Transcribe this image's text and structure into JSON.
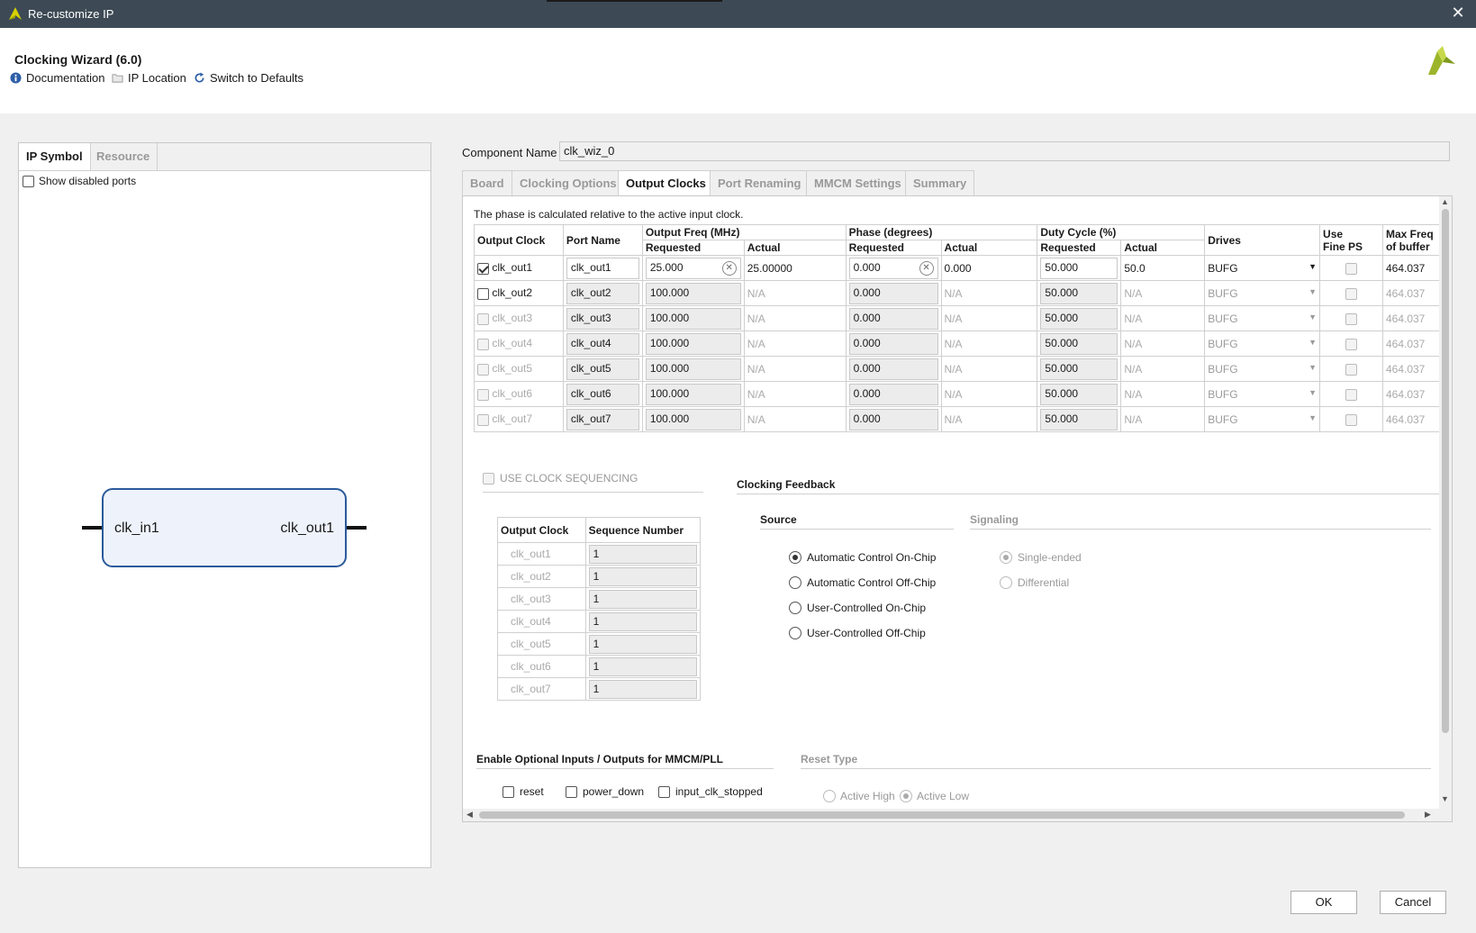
{
  "window": {
    "title": "Re-customize IP"
  },
  "header": {
    "heading": "Clocking Wizard (6.0)",
    "toolbar": [
      {
        "label": "Documentation",
        "icon": "info-icon"
      },
      {
        "label": "IP Location",
        "icon": "folder-icon"
      },
      {
        "label": "Switch to Defaults",
        "icon": "refresh-icon"
      }
    ]
  },
  "left": {
    "tabs": [
      "IP Symbol",
      "Resource"
    ],
    "show_disabled": "Show disabled ports",
    "symbol": {
      "input_port": "clk_in1",
      "output_port": "clk_out1"
    }
  },
  "component": {
    "label": "Component Name",
    "value": "clk_wiz_0"
  },
  "tabs": [
    "Board",
    "Clocking Options",
    "Output Clocks",
    "Port Renaming",
    "MMCM Settings",
    "Summary"
  ],
  "note": "The phase is calculated relative to the active input clock.",
  "table": {
    "headers": {
      "output_clock": "Output Clock",
      "port_name": "Port Name",
      "output_freq": "Output Freq (MHz)",
      "phase": "Phase (degrees)",
      "duty": "Duty Cycle (%)",
      "requested": "Requested",
      "actual": "Actual",
      "drives": "Drives",
      "use_fine_ps_1": "Use",
      "use_fine_ps_2": "Fine PS",
      "max_freq_1": "Max Freq",
      "max_freq_2": "of buffer"
    },
    "rows": [
      {
        "clock": "clk_out1",
        "port": "clk_out1",
        "freq_req": "25.000",
        "freq_act": "25.00000",
        "phase_req": "0.000",
        "phase_act": "0.000",
        "duty_req": "50.000",
        "duty_act": "50.0",
        "drives": "BUFG",
        "max": "464.037"
      },
      {
        "clock": "clk_out2",
        "port": "clk_out2",
        "freq_req": "100.000",
        "freq_act": "N/A",
        "phase_req": "0.000",
        "phase_act": "N/A",
        "duty_req": "50.000",
        "duty_act": "N/A",
        "drives": "BUFG",
        "max": "464.037"
      },
      {
        "clock": "clk_out3",
        "port": "clk_out3",
        "freq_req": "100.000",
        "freq_act": "N/A",
        "phase_req": "0.000",
        "phase_act": "N/A",
        "duty_req": "50.000",
        "duty_act": "N/A",
        "drives": "BUFG",
        "max": "464.037"
      },
      {
        "clock": "clk_out4",
        "port": "clk_out4",
        "freq_req": "100.000",
        "freq_act": "N/A",
        "phase_req": "0.000",
        "phase_act": "N/A",
        "duty_req": "50.000",
        "duty_act": "N/A",
        "drives": "BUFG",
        "max": "464.037"
      },
      {
        "clock": "clk_out5",
        "port": "clk_out5",
        "freq_req": "100.000",
        "freq_act": "N/A",
        "phase_req": "0.000",
        "phase_act": "N/A",
        "duty_req": "50.000",
        "duty_act": "N/A",
        "drives": "BUFG",
        "max": "464.037"
      },
      {
        "clock": "clk_out6",
        "port": "clk_out6",
        "freq_req": "100.000",
        "freq_act": "N/A",
        "phase_req": "0.000",
        "phase_act": "N/A",
        "duty_req": "50.000",
        "duty_act": "N/A",
        "drives": "BUFG",
        "max": "464.037"
      },
      {
        "clock": "clk_out7",
        "port": "clk_out7",
        "freq_req": "100.000",
        "freq_act": "N/A",
        "phase_req": "0.000",
        "phase_act": "N/A",
        "duty_req": "50.000",
        "duty_act": "N/A",
        "drives": "BUFG",
        "max": "464.037"
      }
    ]
  },
  "sequencing": {
    "label": "USE CLOCK SEQUENCING",
    "headers": [
      "Output Clock",
      "Sequence Number"
    ],
    "rows": [
      {
        "clock": "clk_out1",
        "num": "1"
      },
      {
        "clock": "clk_out2",
        "num": "1"
      },
      {
        "clock": "clk_out3",
        "num": "1"
      },
      {
        "clock": "clk_out4",
        "num": "1"
      },
      {
        "clock": "clk_out5",
        "num": "1"
      },
      {
        "clock": "clk_out6",
        "num": "1"
      },
      {
        "clock": "clk_out7",
        "num": "1"
      }
    ]
  },
  "feedback": {
    "title": "Clocking Feedback",
    "source_title": "Source",
    "signaling_title": "Signaling",
    "sources": [
      "Automatic Control On-Chip",
      "Automatic Control Off-Chip",
      "User-Controlled On-Chip",
      "User-Controlled Off-Chip"
    ],
    "selected_source": "Automatic Control On-Chip",
    "signaling": [
      "Single-ended",
      "Differential"
    ]
  },
  "optional": {
    "title": "Enable Optional Inputs / Outputs for MMCM/PLL",
    "items": [
      "reset",
      "power_down",
      "input_clk_stopped"
    ]
  },
  "reset_type": {
    "title": "Reset Type",
    "options": [
      "Active High",
      "Active Low"
    ],
    "selected": "Active Low"
  },
  "buttons": {
    "ok": "OK",
    "cancel": "Cancel"
  },
  "colors": {
    "titlebar": "#3d4a55",
    "symbol_border": "#2b5a9b",
    "brand": "#9bb52a"
  }
}
